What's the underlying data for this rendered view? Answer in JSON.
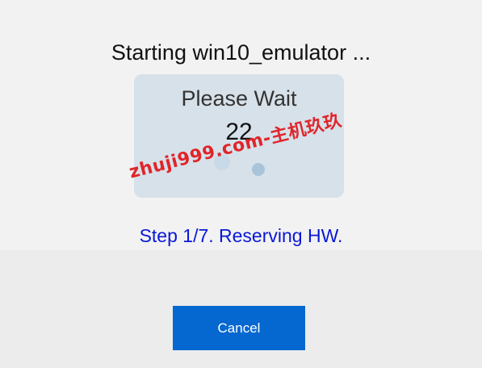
{
  "dialog": {
    "title": "Starting win10_emulator ...",
    "wait_label": "Please Wait",
    "countdown": "22",
    "step_text": "Step 1/7. Reserving HW.",
    "cancel_label": "Cancel"
  },
  "watermark": {
    "text": "zhuji999.com-主机玖玖"
  },
  "colors": {
    "step_text": "#0a18d6",
    "cancel_button": "#0567d0",
    "wait_card": "#d7e1e9",
    "watermark": "#e0252b"
  }
}
